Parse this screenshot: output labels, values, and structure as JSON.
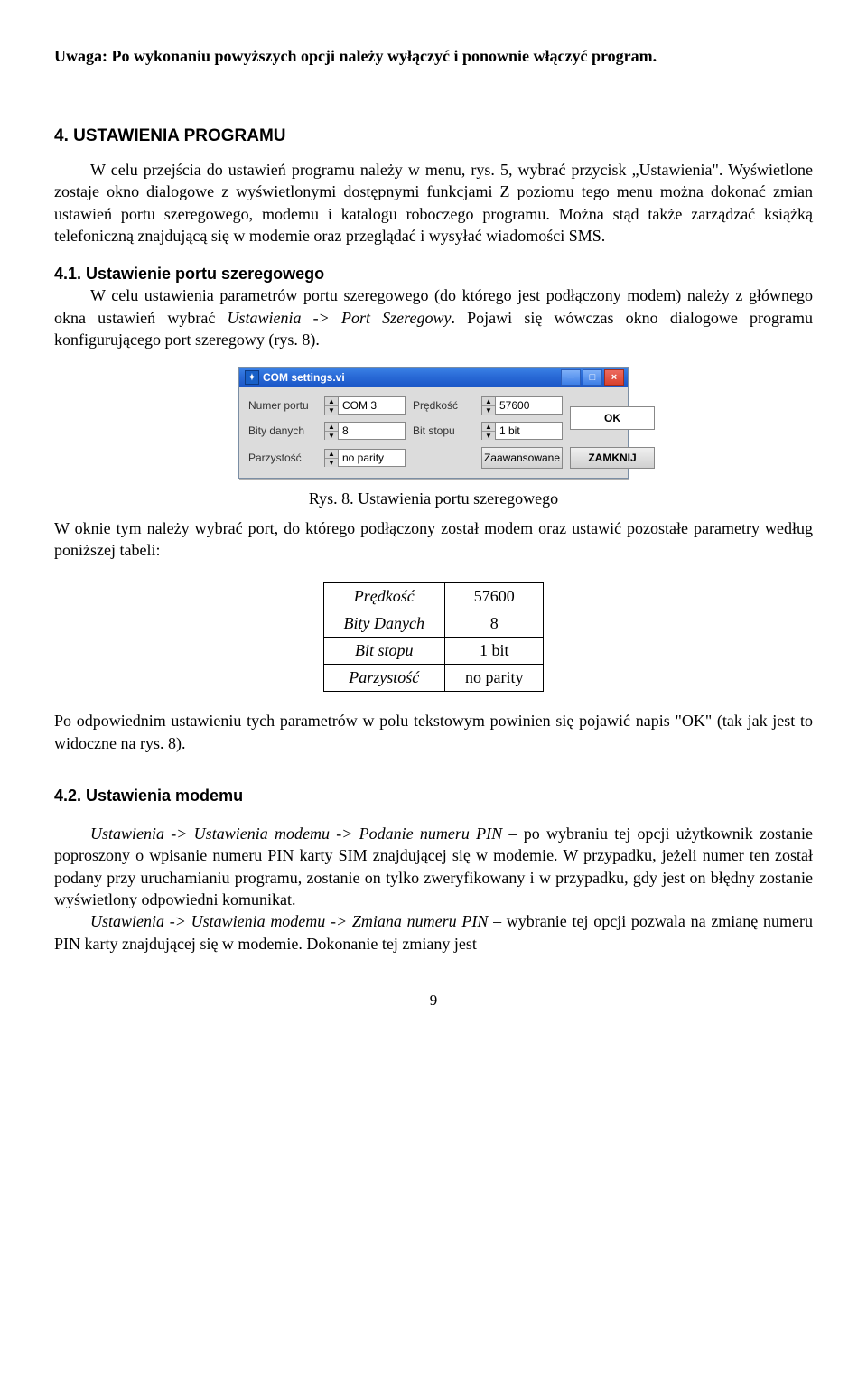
{
  "doc": {
    "notice": "Uwaga: Po wykonaniu powyższych opcji należy wyłączyć i ponownie włączyć program.",
    "s4_heading": "4. USTAWIENIA PROGRAMU",
    "s4_p": "W celu przejścia do ustawień programu należy w menu, rys. 5, wybrać przycisk „Ustawienia\". Wyświetlone zostaje okno dialogowe  z wyświetlonymi dostępnymi funkcjami Z poziomu tego menu można dokonać zmian ustawień portu szeregowego, modemu i katalogu roboczego programu. Można stąd także zarządzać książką telefoniczną znajdującą się w modemie oraz przeglądać i wysyłać wiadomości SMS.",
    "s41_heading": "4.1. Ustawienie portu szeregowego",
    "s41_p1a": "W celu ustawienia parametrów portu szeregowego (do którego jest podłączony modem) należy z głównego okna ustawień wybrać ",
    "s41_p1_em": "Ustawienia -> Port Szeregowy",
    "s41_p1b": ". Pojawi się wówczas okno dialogowe programu konfigurującego port szeregowy (rys. 8).",
    "fig_caption": "Rys. 8. Ustawienia portu szeregowego",
    "s41_p2": "W oknie tym należy wybrać port, do którego podłączony został modem oraz ustawić pozostałe parametry według poniższej tabeli:",
    "s41_p3": "Po odpowiednim ustawieniu tych parametrów w polu tekstowym powinien się pojawić napis \"OK\" (tak jak jest to widoczne na rys. 8).",
    "s42_heading": "4.2. Ustawienia modemu",
    "s42_p1_em": "Ustawienia -> Ustawienia modemu -> Podanie numeru PIN",
    "s42_p1": " – po wybraniu tej opcji użytkownik zostanie poproszony o wpisanie numeru PIN karty SIM znajdującej się w modemie. W przypadku, jeżeli numer ten został podany przy uruchamianiu programu, zostanie on tylko zweryfikowany i w przypadku, gdy jest on błędny zostanie wyświetlony odpowiedni komunikat.",
    "s42_p2_em": "Ustawienia -> Ustawienia modemu -> Zmiana numeru PIN",
    "s42_p2": " – wybranie tej opcji pozwala na zmianę numeru PIN karty znajdującej się w modemie. Dokonanie tej zmiany jest",
    "page_number": "9"
  },
  "dialog": {
    "title": "COM settings.vi",
    "labels": {
      "port": "Numer portu",
      "speed": "Prędkość",
      "databits": "Bity danych",
      "stopbit": "Bit stopu",
      "parity": "Parzystość"
    },
    "values": {
      "port": "COM 3",
      "speed": "57600",
      "databits": "8",
      "stopbit": "1 bit",
      "parity": "no parity"
    },
    "status": "OK",
    "buttons": {
      "advanced": "Zaawansowane",
      "close": "ZAMKNIJ"
    },
    "win": {
      "min": "─",
      "max": "□",
      "close": "×"
    }
  },
  "table": {
    "rows": [
      {
        "name": "Prędkość",
        "value": "57600"
      },
      {
        "name": "Bity Danych",
        "value": "8"
      },
      {
        "name": "Bit stopu",
        "value": "1 bit"
      },
      {
        "name": "Parzystość",
        "value": "no parity"
      }
    ]
  }
}
